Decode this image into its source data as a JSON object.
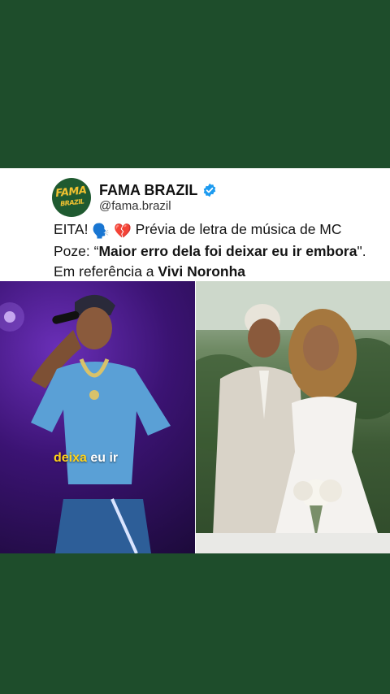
{
  "account": {
    "name": "FAMA BRAZIL",
    "handle": "@fama.brazil",
    "logo_line1": "FAMA",
    "logo_line2": "BRAZIL",
    "verified": true
  },
  "post": {
    "part1": "EITA! ",
    "emoji1": "🗣️",
    "emoji2": "💔",
    "part2": " Prévia de letra de música de MC Poze: “",
    "bold1": "Maior erro dela foi deixar eu ir embora",
    "part3": "\". Em referência a ",
    "bold2": "Vivi Noronha"
  },
  "media": {
    "caption_highlight": "deixa",
    "caption_rest": " eu ir"
  },
  "colors": {
    "page_bg": "#1e4d2b",
    "verified": "#1d9bf0",
    "caption_highlight": "#ffd21a"
  }
}
